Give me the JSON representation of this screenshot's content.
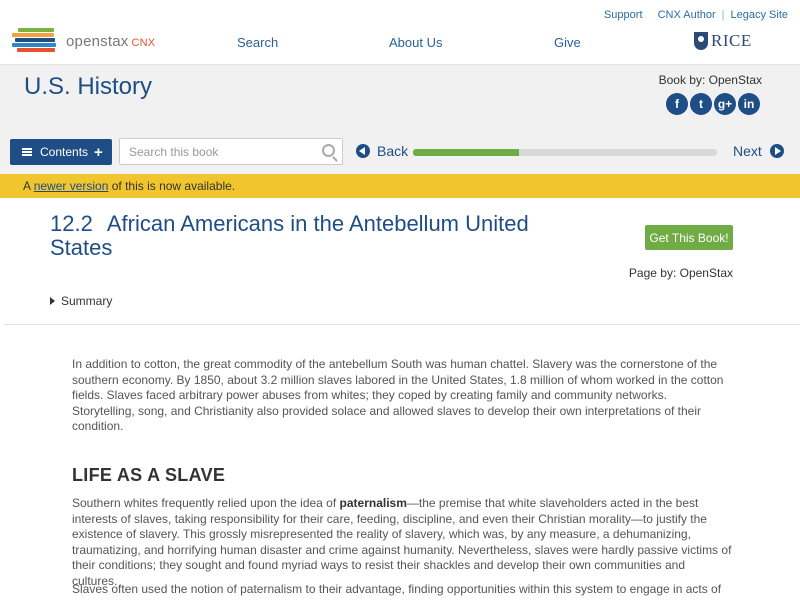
{
  "header": {
    "logo_text": "openstax",
    "logo_suffix": "CNX",
    "links": [
      "Support",
      "CNX Author",
      "Legacy Site"
    ],
    "nav": [
      "Search",
      "About Us",
      "Give"
    ],
    "partner": "RICE"
  },
  "book": {
    "title": "U.S. History",
    "by": "Book by: OpenStax",
    "social": [
      {
        "icon": "facebook-icon",
        "glyph": "f"
      },
      {
        "icon": "twitter-icon",
        "glyph": "t"
      },
      {
        "icon": "google-plus-icon",
        "glyph": "g+"
      },
      {
        "icon": "linkedin-icon",
        "glyph": "in"
      }
    ]
  },
  "toolbar": {
    "contents_label": "Contents",
    "search_placeholder": "Search this book",
    "back_label": "Back",
    "next_label": "Next",
    "progress": 0.35
  },
  "notice": {
    "prefix": "A ",
    "link": "newer version",
    "suffix": " of this is now available."
  },
  "page": {
    "number": "12.2",
    "title": "African Americans in the Antebellum United States",
    "get_book": "Get This Book!",
    "page_by": "Page by: OpenStax",
    "summary": "Summary",
    "intro": "In addition to cotton, the great commodity of the antebellum South was human chattel. Slavery was the cornerstone of the southern economy. By 1850, about 3.2 million slaves labored in the United States, 1.8 million of whom worked in the cotton fields. Slaves faced arbitrary power abuses from whites; they coped by creating family and community networks. Storytelling, song, and Christianity also provided solace and allowed slaves to develop their own interpretations of their condition.",
    "section_heading": "LIFE AS A SLAVE",
    "p2_before": "Southern whites frequently relied upon the idea of ",
    "p2_term": "paternalism",
    "p2_after": "—the premise that white slaveholders acted in the best interests of slaves, taking responsibility for their care, feeding, discipline, and even their Christian morality—to justify the existence of slavery. This grossly misrepresented the reality of slavery, which was, by any measure, a dehumanizing, traumatizing, and horrifying human disaster and crime against humanity. Nevertheless, slaves were hardly passive victims of their conditions; they sought and found myriad ways to resist their shackles and develop their own communities and cultures.",
    "p3": "Slaves often used the notion of paternalism to their advantage, finding opportunities within this system to engage in acts of resistance"
  },
  "colors": {
    "brand_blue": "#1f4d86",
    "green": "#6fac44",
    "notice_yellow": "#f0c52e"
  }
}
